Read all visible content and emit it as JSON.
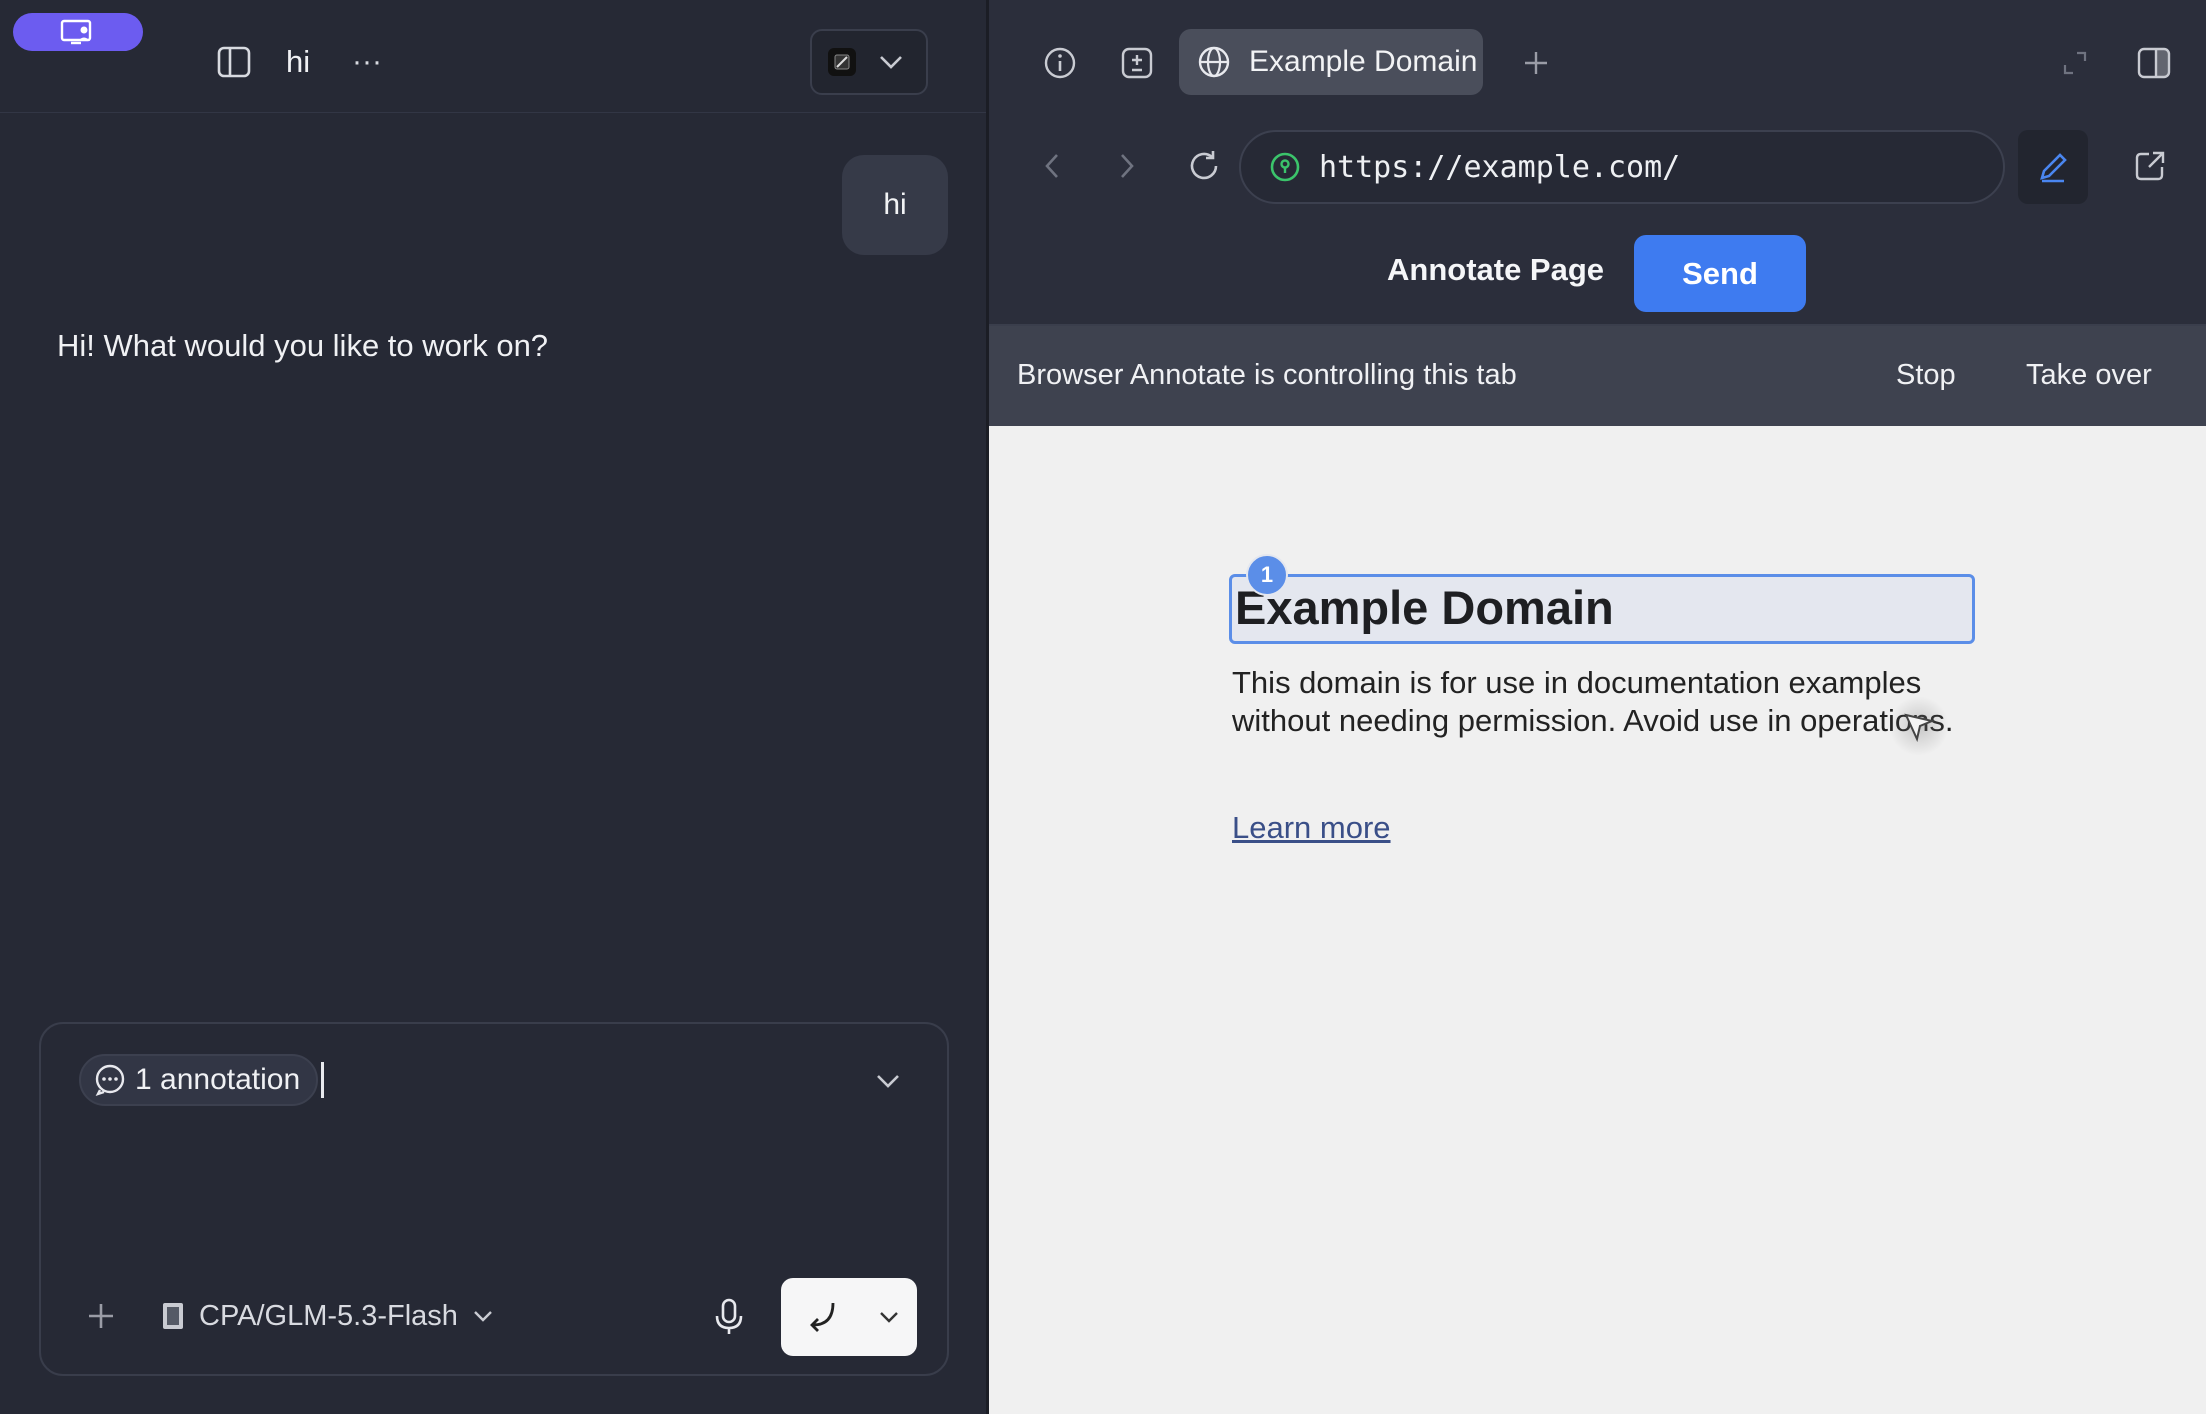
{
  "chat": {
    "title": "hi",
    "more_label": "···",
    "messages": {
      "user": "hi",
      "assistant": "Hi! What would you like to work on?"
    },
    "composer": {
      "annotation_chip": "1 annotation",
      "model": "CPA/GLM-5.3-Flash"
    }
  },
  "browser": {
    "tab_title": "Example Domain",
    "url": "https://example.com/",
    "annotate_title": "Annotate Page",
    "send_label": "Send",
    "control_text": "Browser Annotate is controlling this tab",
    "stop_label": "Stop",
    "takeover_label": "Take over",
    "page": {
      "heading": "Example Domain",
      "badge": "1",
      "paragraph": "This domain is for use in documentation examples without needing permission. Avoid use in operations.",
      "link": "Learn more"
    }
  },
  "colors": {
    "accent_purple": "#6c5cf0",
    "send_blue": "#3e7bf0",
    "highlight_blue": "#5b8ee8",
    "link": "#3a4f88",
    "secure_green": "#3bc46b"
  }
}
